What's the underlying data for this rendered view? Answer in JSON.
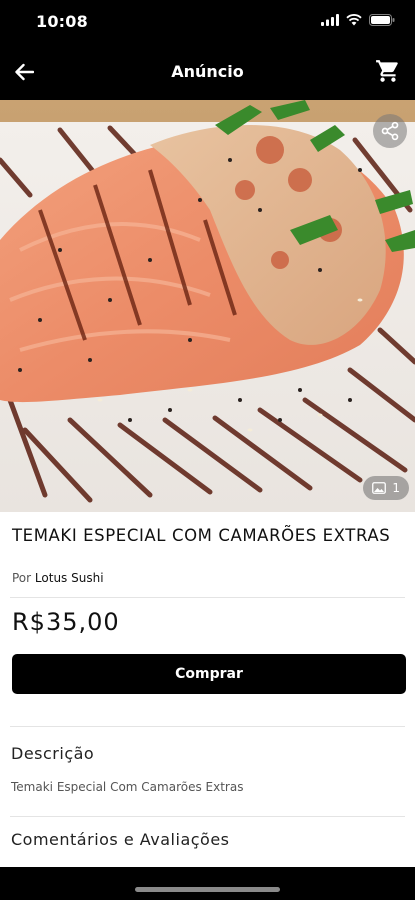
{
  "status_bar": {
    "time": "10:08"
  },
  "nav": {
    "title": "Anúncio",
    "back_icon": "arrow-left-icon",
    "cart_icon": "cart-icon"
  },
  "photo": {
    "count": "1",
    "share_icon": "share-icon",
    "gallery_icon": "image-icon"
  },
  "product": {
    "title": "TEMAKI ESPECIAL COM CAMARÕES EXTRAS",
    "seller_prefix": "Por",
    "seller_name": "Lotus Sushi",
    "price": "R$35,00",
    "buy_label": "Comprar"
  },
  "description": {
    "heading": "Descrição",
    "text": "Temaki Especial Com Camarões Extras"
  },
  "reviews": {
    "heading": "Comentários e Avaliações"
  },
  "colors": {
    "accent": "#000000",
    "background": "#ffffff"
  }
}
